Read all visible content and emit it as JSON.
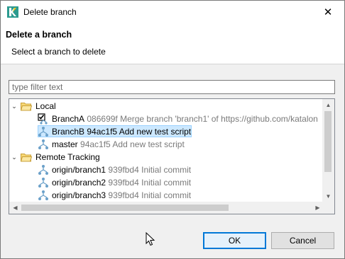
{
  "window": {
    "title": "Delete branch",
    "close_glyph": "✕"
  },
  "header": {
    "title": "Delete a branch",
    "message": "Select a branch to delete"
  },
  "filter": {
    "placeholder": "type filter text",
    "value": ""
  },
  "tree": {
    "local": {
      "label": "Local",
      "twisty": "⌄",
      "items": [
        {
          "name": "BranchA",
          "detail": "086699f Merge branch 'branch1' of https://github.com/katalon"
        },
        {
          "name": "BranchB",
          "detail": "94ac1f5 Add new test script"
        },
        {
          "name": "master",
          "detail": "94ac1f5 Add new test script"
        }
      ]
    },
    "remote": {
      "label": "Remote Tracking",
      "twisty": "⌄",
      "items": [
        {
          "name": "origin/branch1",
          "detail": "939fbd4 Initial commit"
        },
        {
          "name": "origin/branch2",
          "detail": "939fbd4 Initial commit"
        },
        {
          "name": "origin/branch3",
          "detail": "939fbd4 Initial commit"
        }
      ]
    },
    "selected_item": "BranchB"
  },
  "buttons": {
    "ok": "OK",
    "cancel": "Cancel"
  },
  "scroll": {
    "up": "▲",
    "down": "▼",
    "left": "◀",
    "right": "▶"
  },
  "colors": {
    "selection": "#cce8ff",
    "accent": "#0078d7",
    "dim_text": "#7a7a7a"
  }
}
